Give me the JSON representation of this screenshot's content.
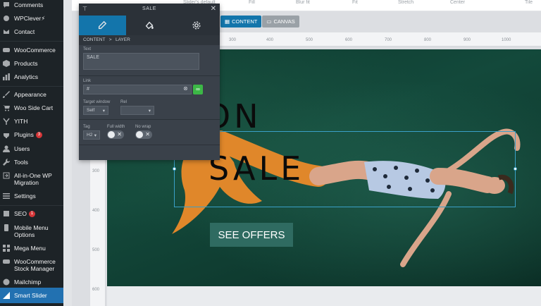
{
  "wp_sidebar": {
    "items": [
      {
        "label": "Comments",
        "icon": "comments-icon"
      },
      {
        "label": "WPClever⚡",
        "icon": "plugin-icon"
      },
      {
        "label": "Contact",
        "icon": "envelope-icon"
      },
      {
        "label": "WooCommerce",
        "icon": "woocommerce-icon"
      },
      {
        "label": "Products",
        "icon": "box-icon"
      },
      {
        "label": "Analytics",
        "icon": "bar-chart-icon"
      },
      {
        "label": "Appearance",
        "icon": "brush-icon"
      },
      {
        "label": "Woo Side Cart",
        "icon": "cart-icon"
      },
      {
        "label": "YITH",
        "icon": "yith-icon"
      },
      {
        "label": "Plugins",
        "icon": "plug-icon",
        "badge": "3"
      },
      {
        "label": "Users",
        "icon": "user-icon"
      },
      {
        "label": "Tools",
        "icon": "wrench-icon"
      },
      {
        "label": "All-in-One WP Migration",
        "icon": "migration-icon"
      },
      {
        "label": "Settings",
        "icon": "settings-icon"
      },
      {
        "label": "SEO",
        "icon": "seo-icon",
        "badge": "1"
      },
      {
        "label": "Mobile Menu Options",
        "icon": "menu-icon"
      },
      {
        "label": "Mega Menu",
        "icon": "mega-menu-icon"
      },
      {
        "label": "WooCommerce Stock Manager",
        "icon": "stock-icon"
      },
      {
        "label": "Mailchimp",
        "icon": "mailchimp-icon"
      },
      {
        "label": "Smart Slider",
        "icon": "smart-slider-icon",
        "active": true
      }
    ]
  },
  "bg_modes": [
    "Slider's default",
    "Fill",
    "Blur fit",
    "Fit",
    "Stretch",
    "Center",
    "Tile"
  ],
  "view_tabs": {
    "content": "CONTENT",
    "canvas": "CANVAS"
  },
  "ruler_top": [
    "300",
    "400",
    "500",
    "600",
    "700",
    "800",
    "900",
    "1000"
  ],
  "ruler_left": [
    "300",
    "400",
    "500",
    "600"
  ],
  "layer_panel": {
    "title": "SALE",
    "breadcrumb_parent": "CONTENT",
    "breadcrumb_current": "LAYER",
    "text_label": "Text",
    "text_value": "SALE",
    "link_label": "Link",
    "link_value": "#",
    "target_label": "Target window",
    "target_value": "Self",
    "rel_label": "Rel",
    "rel_value": "",
    "tag_label": "Tag",
    "tag_value": "H2",
    "fullwidth_label": "Full width",
    "nowrap_label": "No wrap"
  },
  "slide": {
    "season": "SEASON",
    "sale": "SALE",
    "cta": "SEE OFFERS"
  },
  "colors": {
    "admin_bar": "#1d2327",
    "active_menu": "#2271b1",
    "accent_blue": "#1375ab",
    "cta_bg": "#2f6b61",
    "link_green": "#3cb846"
  }
}
